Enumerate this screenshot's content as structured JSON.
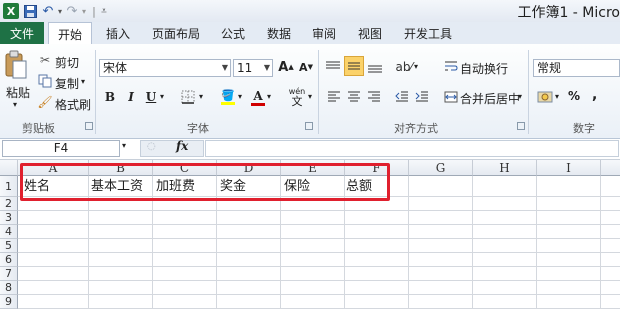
{
  "window": {
    "title": "工作簿1 - Micro"
  },
  "quick_access": {
    "app_icon": "X",
    "save_icon": "save-icon",
    "undo_icon": "undo-icon",
    "redo_icon": "redo-icon"
  },
  "tabs": [
    "文件",
    "开始",
    "插入",
    "页面布局",
    "公式",
    "数据",
    "审阅",
    "视图",
    "开发工具"
  ],
  "clipboard": {
    "paste": "粘贴",
    "cut": "剪切",
    "copy": "复制",
    "format_painter": "格式刷",
    "label": "剪贴板"
  },
  "font": {
    "name": "宋体",
    "size": "11",
    "grow": "A",
    "shrink": "A",
    "bold": "B",
    "italic": "I",
    "underline": "U",
    "color_letter": "A",
    "wen": "wén",
    "label": "字体"
  },
  "alignment": {
    "wrap_text": "自动换行",
    "merge_center": "合并后居中",
    "label": "对齐方式"
  },
  "number": {
    "format": "常规",
    "percent": "%",
    "comma": ",",
    "label": "数字"
  },
  "formula_bar": {
    "name_box": "F4",
    "fx": "fx",
    "content": ""
  },
  "columns": [
    "A",
    "B",
    "C",
    "D",
    "E",
    "F",
    "G",
    "H",
    "I"
  ],
  "rows": [
    "1",
    "2",
    "3",
    "4",
    "5",
    "6",
    "7",
    "8",
    "9"
  ],
  "row1_cells": [
    "姓名",
    "基本工资",
    "加班费",
    "奖金",
    "保险",
    "总额"
  ],
  "colors": {
    "file_tab": "#1e7145",
    "highlight_border": "#e0202e",
    "font_color_bar": "#d00000",
    "fill_color_bar": "#ffff00"
  }
}
